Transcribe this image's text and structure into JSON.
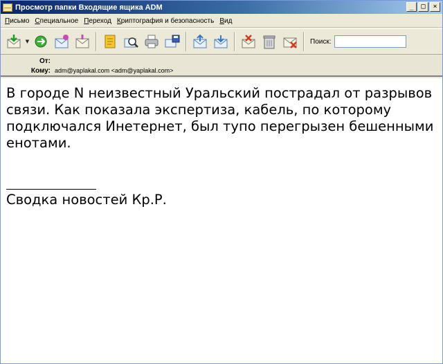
{
  "window": {
    "title": "Просмотр папки Входящие ящика ADM"
  },
  "menu": [
    {
      "accel": "П",
      "rest": "исьмо"
    },
    {
      "accel": "С",
      "rest": "пециальное"
    },
    {
      "accel": "П",
      "rest": "ереход"
    },
    {
      "accel": "К",
      "rest": "риптография и безопасность"
    },
    {
      "accel": "В",
      "rest": "ид"
    }
  ],
  "toolbar": {
    "buttons": [
      "get-mail",
      "forward",
      "reply-all",
      "compose",
      "notes",
      "find",
      "print",
      "save",
      "move-up",
      "move-down",
      "mark-unread",
      "delete",
      "spam"
    ],
    "search_label": "Поиск:",
    "search_value": ""
  },
  "headers": {
    "from_label": "От:",
    "from_value": "",
    "to_label": "Кому:",
    "to_value": "adm@yaplakal.com <adm@yaplakal.com>"
  },
  "message": {
    "body": "В городе N неизвестный Уральский пострадал от разрывов связи. Как показала экспертиза, кабель, по которому подключался Инетернет, был тупо перегрызен бешенными енотами.",
    "signature": "Сводка новостей Кр.Р."
  },
  "colors": {
    "title_start": "#0a246a",
    "title_end": "#a6caf0",
    "chrome": "#ece9d8"
  }
}
